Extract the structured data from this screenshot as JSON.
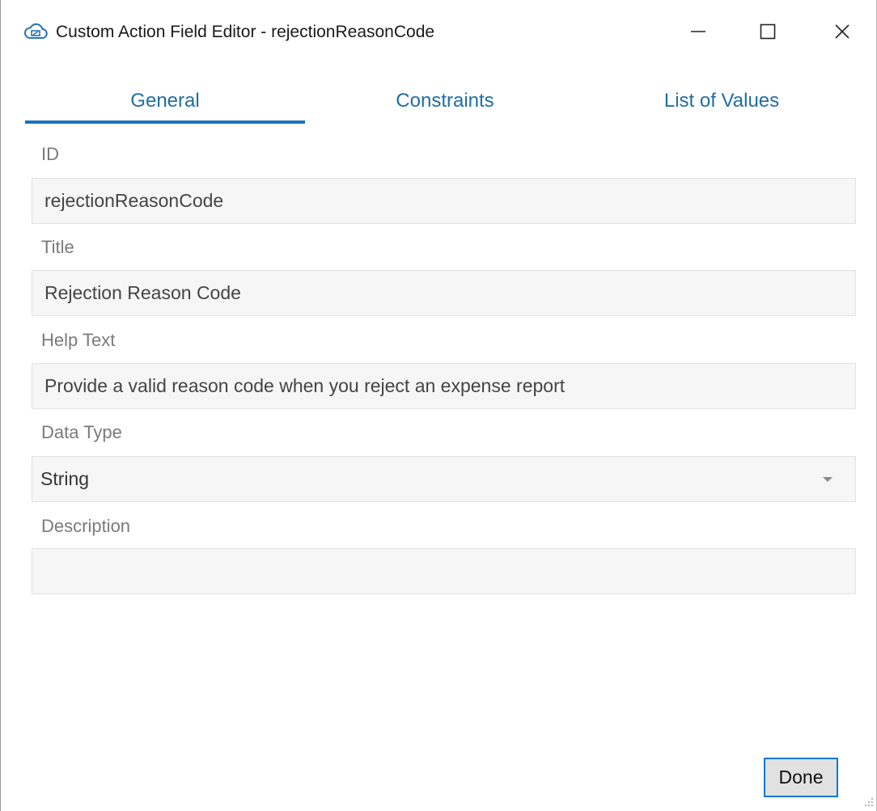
{
  "window": {
    "title": "Custom Action Field Editor - rejectionReasonCode",
    "icons": {
      "app": "cloud-icon",
      "minimize": "minimize-icon",
      "maximize": "maximize-icon",
      "close": "close-icon"
    }
  },
  "tabs": [
    {
      "label": "General",
      "active": true
    },
    {
      "label": "Constraints",
      "active": false
    },
    {
      "label": "List of Values",
      "active": false
    }
  ],
  "form": {
    "id": {
      "label": "ID",
      "value": "rejectionReasonCode"
    },
    "title": {
      "label": "Title",
      "value": "Rejection Reason Code"
    },
    "help_text": {
      "label": "Help Text",
      "value": "Provide a valid reason code when you reject an expense report"
    },
    "data_type": {
      "label": "Data Type",
      "value": "String"
    },
    "description": {
      "label": "Description",
      "value": ""
    }
  },
  "footer": {
    "done_label": "Done"
  },
  "colors": {
    "accent": "#1b75bc",
    "tab_text": "#1e6ea6",
    "field_bg": "#f6f6f6",
    "button_border": "#0078d7"
  }
}
